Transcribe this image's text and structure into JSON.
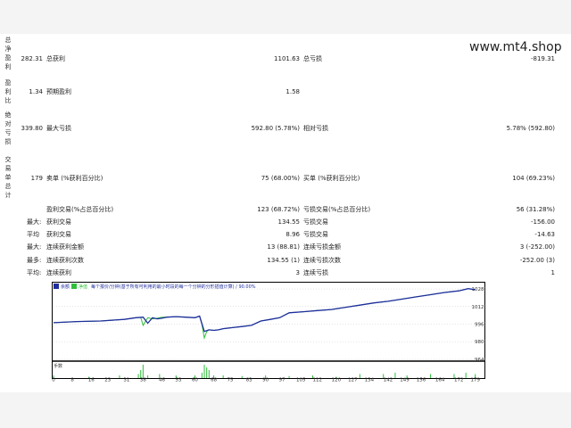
{
  "watermark": "www.mt4.shop",
  "side_labels": [
    "总净盈利",
    "盈利比",
    "绝对亏损",
    "交易单总计"
  ],
  "report_rows": [
    {
      "prefix": "",
      "v1": "282.31",
      "l1": "总获利",
      "v2": "1101.63",
      "l2": "总亏损",
      "v3": "-819.31"
    },
    {
      "prefix": "",
      "v1": "1.34",
      "l1": "预期盈利",
      "v2": "1.58",
      "l2": "",
      "v3": ""
    },
    {
      "prefix": "",
      "v1": "339.80",
      "l1": "最大亏损",
      "v2": "592.80 (5.78%)",
      "l2": "相对亏损",
      "v3": "5.78% (592.80)"
    },
    {
      "prefix": "",
      "v1": "179",
      "l1": "卖单 (%获利百分比)",
      "v2": "75 (68.00%)",
      "l2": "买单 (%获利百分比)",
      "v3": "104 (69.23%)"
    },
    {
      "prefix": "",
      "v1": "",
      "l1": "盈利交易(%占总百分比)",
      "v2": "123 (68.72%)",
      "l2": "亏损交易(%占总百分比)",
      "v3": "56 (31.28%)"
    },
    {
      "prefix": "最大:",
      "v1": "",
      "l1": "获利交易",
      "v2": "134.55",
      "l2": "亏损交易",
      "v3": "-156.00"
    },
    {
      "prefix": "平均",
      "v1": "",
      "l1": "获利交易",
      "v2": "8.96",
      "l2": "亏损交易",
      "v3": "-14.63"
    },
    {
      "prefix": "最大:",
      "v1": "",
      "l1": "连续获利金额",
      "v2": "13 (88.81)",
      "l2": "连续亏损金额",
      "v3": "3 (-252.00)"
    },
    {
      "prefix": "最多:",
      "v1": "",
      "l1": "连续获利次数",
      "v2": "134.55 (1)",
      "l2": "连续亏损次数",
      "v3": "-252.00 (3)"
    },
    {
      "prefix": "平均:",
      "v1": "",
      "l1": "连续获利",
      "v2": "3",
      "l2": "连续亏损",
      "v3": "1"
    }
  ],
  "chart_legend": {
    "balance": "余额",
    "equity": "净值",
    "text": "每个报价/分钟(基于所有可利用的最小时段的每一个分钟的分形插值计算) / 90.00%"
  },
  "volume_label": "手数",
  "colors": {
    "balance": "#1f2e9e",
    "equity": "#2fbf3a",
    "volume": "#2fbf3a",
    "grid": "#c8c8c8",
    "border": "#000000"
  },
  "chart_data": {
    "type": "line",
    "series": [
      {
        "name": "余额",
        "x": [
          0,
          10,
          20,
          30,
          35,
          38,
          40,
          42,
          44,
          46,
          48,
          52,
          56,
          60,
          62,
          64,
          66,
          68,
          70,
          72,
          76,
          80,
          84,
          88,
          92,
          96,
          100,
          106,
          112,
          118,
          124,
          130,
          136,
          142,
          148,
          154,
          160,
          166,
          172,
          176,
          179
        ],
        "values": [
          9980,
          9990,
          9995,
          10010,
          10025,
          10030,
          9975,
          10025,
          10015,
          10020,
          10030,
          10035,
          10030,
          10025,
          10040,
          9900,
          9915,
          9910,
          9915,
          9925,
          9935,
          9945,
          9955,
          9995,
          10010,
          10025,
          10070,
          10080,
          10090,
          10100,
          10120,
          10140,
          10160,
          10175,
          10195,
          10215,
          10235,
          10255,
          10270,
          10290,
          10280
        ]
      },
      {
        "name": "净值",
        "x": [
          0,
          10,
          20,
          30,
          35,
          37,
          38,
          40,
          42,
          44,
          46,
          48,
          52,
          56,
          60,
          62,
          63,
          64,
          65,
          66,
          68,
          70,
          72,
          76,
          80,
          84,
          88,
          92,
          96,
          100,
          106,
          112,
          118,
          124,
          130,
          136,
          142,
          148,
          154,
          160,
          166,
          172,
          176,
          179
        ],
        "values": [
          9980,
          9990,
          9995,
          10010,
          10025,
          10028,
          9955,
          10025,
          10015,
          10020,
          10030,
          10030,
          10035,
          10030,
          10025,
          10040,
          9960,
          9840,
          9900,
          9915,
          9910,
          9915,
          9925,
          9935,
          9945,
          9955,
          9995,
          10010,
          10025,
          10070,
          10080,
          10090,
          10100,
          10120,
          10140,
          10160,
          10175,
          10195,
          10215,
          10235,
          10255,
          10270,
          10290,
          10280
        ]
      }
    ],
    "volume": {
      "x": [
        0,
        15,
        28,
        36,
        37,
        38,
        40,
        45,
        52,
        60,
        63,
        64,
        65,
        66,
        68,
        72,
        80,
        90,
        100,
        110,
        120,
        130,
        140,
        145,
        150,
        160,
        170,
        175,
        179
      ],
      "values": [
        0.2,
        0.1,
        0.2,
        0.3,
        0.6,
        1.0,
        0.2,
        0.3,
        0.2,
        0.2,
        0.4,
        1.0,
        0.8,
        0.6,
        0.2,
        0.2,
        0.15,
        0.2,
        0.15,
        0.2,
        0.1,
        0.3,
        0.3,
        0.4,
        0.2,
        0.3,
        0.3,
        0.4,
        0.3
      ]
    },
    "y_ticks": [
      "10287",
      "10127",
      "9967",
      "9807",
      "9646"
    ],
    "y_tick_values": [
      10287,
      10127,
      9967,
      9807,
      9646
    ],
    "ylim": [
      9646,
      10320
    ],
    "x_ticks": [
      "0",
      "8",
      "16",
      "23",
      "31",
      "38",
      "46",
      "53",
      "60",
      "68",
      "75",
      "83",
      "90",
      "97",
      "105",
      "112",
      "120",
      "127",
      "134",
      "142",
      "149",
      "156",
      "164",
      "172",
      "179"
    ],
    "xlim": [
      0,
      181
    ]
  }
}
